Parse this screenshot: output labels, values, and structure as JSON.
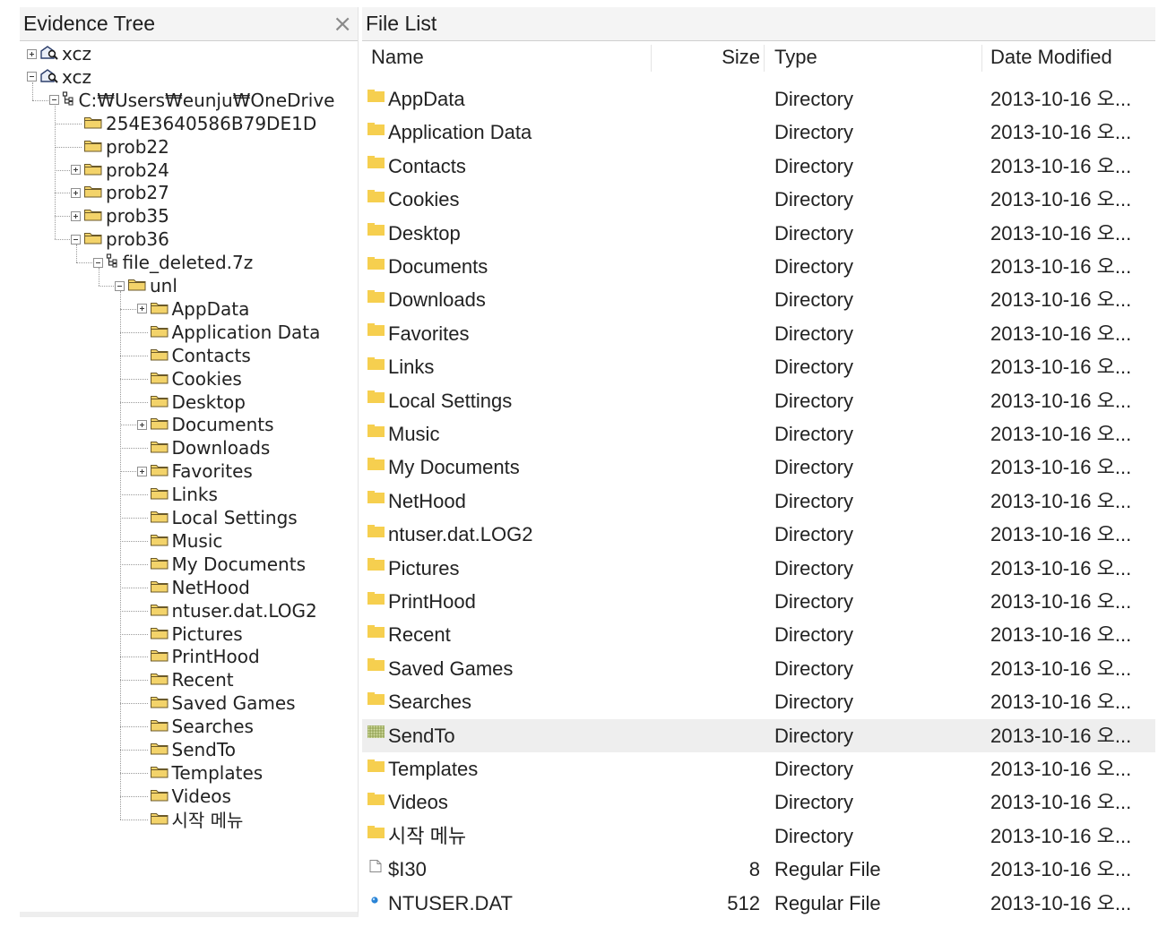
{
  "tree_pane": {
    "title": "Evidence Tree",
    "close_label": "×",
    "nodes": [
      {
        "label": "xcz",
        "depth": 0,
        "icon": "evidence-icon",
        "expander": "plus"
      },
      {
        "label": "xcz",
        "depth": 0,
        "icon": "evidence-icon",
        "expander": "minus"
      },
      {
        "label": "C:₩Users₩eunju₩OneDrive",
        "depth": 1,
        "icon": "drive-tree-icon",
        "expander": "minus"
      },
      {
        "label": "254E3640586B79DE1D",
        "depth": 2,
        "icon": "folder-icon",
        "expander": "none"
      },
      {
        "label": "prob22",
        "depth": 2,
        "icon": "folder-icon",
        "expander": "none"
      },
      {
        "label": "prob24",
        "depth": 2,
        "icon": "folder-icon",
        "expander": "plus"
      },
      {
        "label": "prob27",
        "depth": 2,
        "icon": "folder-icon",
        "expander": "plus"
      },
      {
        "label": "prob35",
        "depth": 2,
        "icon": "folder-icon",
        "expander": "plus"
      },
      {
        "label": "prob36",
        "depth": 2,
        "icon": "folder-icon",
        "expander": "minus"
      },
      {
        "label": "file_deleted.7z",
        "depth": 3,
        "icon": "archive-tree-icon",
        "expander": "minus"
      },
      {
        "label": "unl",
        "depth": 4,
        "icon": "folder-icon",
        "expander": "minus"
      },
      {
        "label": "AppData",
        "depth": 5,
        "icon": "folder-icon",
        "expander": "plus"
      },
      {
        "label": "Application Data",
        "depth": 5,
        "icon": "folder-icon",
        "expander": "none"
      },
      {
        "label": "Contacts",
        "depth": 5,
        "icon": "folder-icon",
        "expander": "none"
      },
      {
        "label": "Cookies",
        "depth": 5,
        "icon": "folder-icon",
        "expander": "none"
      },
      {
        "label": "Desktop",
        "depth": 5,
        "icon": "folder-icon",
        "expander": "none"
      },
      {
        "label": "Documents",
        "depth": 5,
        "icon": "folder-icon",
        "expander": "plus"
      },
      {
        "label": "Downloads",
        "depth": 5,
        "icon": "folder-icon",
        "expander": "none"
      },
      {
        "label": "Favorites",
        "depth": 5,
        "icon": "folder-icon",
        "expander": "plus"
      },
      {
        "label": "Links",
        "depth": 5,
        "icon": "folder-icon",
        "expander": "none"
      },
      {
        "label": "Local Settings",
        "depth": 5,
        "icon": "folder-icon",
        "expander": "none"
      },
      {
        "label": "Music",
        "depth": 5,
        "icon": "folder-icon",
        "expander": "none"
      },
      {
        "label": "My Documents",
        "depth": 5,
        "icon": "folder-icon",
        "expander": "none"
      },
      {
        "label": "NetHood",
        "depth": 5,
        "icon": "folder-icon",
        "expander": "none"
      },
      {
        "label": "ntuser.dat.LOG2",
        "depth": 5,
        "icon": "folder-icon",
        "expander": "none"
      },
      {
        "label": "Pictures",
        "depth": 5,
        "icon": "folder-icon",
        "expander": "none"
      },
      {
        "label": "PrintHood",
        "depth": 5,
        "icon": "folder-icon",
        "expander": "none"
      },
      {
        "label": "Recent",
        "depth": 5,
        "icon": "folder-icon",
        "expander": "none"
      },
      {
        "label": "Saved Games",
        "depth": 5,
        "icon": "folder-icon",
        "expander": "none"
      },
      {
        "label": "Searches",
        "depth": 5,
        "icon": "folder-icon",
        "expander": "none"
      },
      {
        "label": "SendTo",
        "depth": 5,
        "icon": "folder-icon",
        "expander": "none"
      },
      {
        "label": "Templates",
        "depth": 5,
        "icon": "folder-icon",
        "expander": "none"
      },
      {
        "label": "Videos",
        "depth": 5,
        "icon": "folder-icon",
        "expander": "none"
      },
      {
        "label": "시작 메뉴",
        "depth": 5,
        "icon": "folder-icon",
        "expander": "none"
      }
    ]
  },
  "list_pane": {
    "title": "File List",
    "columns": {
      "name": "Name",
      "size": "Size",
      "type": "Type",
      "date": "Date Modified"
    },
    "selected_row": 19,
    "rows": [
      {
        "name": "AppData",
        "size": "",
        "type": "Directory",
        "date": "2013-10-16 오...",
        "icon": "folder-icon"
      },
      {
        "name": "Application Data",
        "size": "",
        "type": "Directory",
        "date": "2013-10-16 오...",
        "icon": "folder-icon"
      },
      {
        "name": "Contacts",
        "size": "",
        "type": "Directory",
        "date": "2013-10-16 오...",
        "icon": "folder-icon"
      },
      {
        "name": "Cookies",
        "size": "",
        "type": "Directory",
        "date": "2013-10-16 오...",
        "icon": "folder-icon"
      },
      {
        "name": "Desktop",
        "size": "",
        "type": "Directory",
        "date": "2013-10-16 오...",
        "icon": "folder-icon"
      },
      {
        "name": "Documents",
        "size": "",
        "type": "Directory",
        "date": "2013-10-16 오...",
        "icon": "folder-icon"
      },
      {
        "name": "Downloads",
        "size": "",
        "type": "Directory",
        "date": "2013-10-16 오...",
        "icon": "folder-icon"
      },
      {
        "name": "Favorites",
        "size": "",
        "type": "Directory",
        "date": "2013-10-16 오...",
        "icon": "folder-icon"
      },
      {
        "name": "Links",
        "size": "",
        "type": "Directory",
        "date": "2013-10-16 오...",
        "icon": "folder-icon"
      },
      {
        "name": "Local Settings",
        "size": "",
        "type": "Directory",
        "date": "2013-10-16 오...",
        "icon": "folder-icon"
      },
      {
        "name": "Music",
        "size": "",
        "type": "Directory",
        "date": "2013-10-16 오...",
        "icon": "folder-icon"
      },
      {
        "name": "My Documents",
        "size": "",
        "type": "Directory",
        "date": "2013-10-16 오...",
        "icon": "folder-icon"
      },
      {
        "name": "NetHood",
        "size": "",
        "type": "Directory",
        "date": "2013-10-16 오...",
        "icon": "folder-icon"
      },
      {
        "name": "ntuser.dat.LOG2",
        "size": "",
        "type": "Directory",
        "date": "2013-10-16 오...",
        "icon": "folder-icon"
      },
      {
        "name": "Pictures",
        "size": "",
        "type": "Directory",
        "date": "2013-10-16 오...",
        "icon": "folder-icon"
      },
      {
        "name": "PrintHood",
        "size": "",
        "type": "Directory",
        "date": "2013-10-16 오...",
        "icon": "folder-icon"
      },
      {
        "name": "Recent",
        "size": "",
        "type": "Directory",
        "date": "2013-10-16 오...",
        "icon": "folder-icon"
      },
      {
        "name": "Saved Games",
        "size": "",
        "type": "Directory",
        "date": "2013-10-16 오...",
        "icon": "folder-icon"
      },
      {
        "name": "Searches",
        "size": "",
        "type": "Directory",
        "date": "2013-10-16 오...",
        "icon": "folder-icon"
      },
      {
        "name": "SendTo",
        "size": "",
        "type": "Directory",
        "date": "2013-10-16 오...",
        "icon": "grid-folder-icon"
      },
      {
        "name": "Templates",
        "size": "",
        "type": "Directory",
        "date": "2013-10-16 오...",
        "icon": "folder-icon"
      },
      {
        "name": "Videos",
        "size": "",
        "type": "Directory",
        "date": "2013-10-16 오...",
        "icon": "folder-icon"
      },
      {
        "name": "시작 메뉴",
        "size": "",
        "type": "Directory",
        "date": "2013-10-16 오...",
        "icon": "folder-icon"
      },
      {
        "name": "$I30",
        "size": "8",
        "type": "Regular File",
        "date": "2013-10-16 오...",
        "icon": "file-icon"
      },
      {
        "name": "NTUSER.DAT",
        "size": "512",
        "type": "Regular File",
        "date": "2013-10-16 오...",
        "icon": "dot-file-icon"
      }
    ]
  },
  "colors": {
    "folder_fill": "#f3d36a",
    "folder_edge": "#6b5a2a",
    "list_folder": "#f6cf4f",
    "selected_row": "#eeeeee",
    "header_bg": "#f4f4f4",
    "dot_file": "#2a84d6"
  }
}
